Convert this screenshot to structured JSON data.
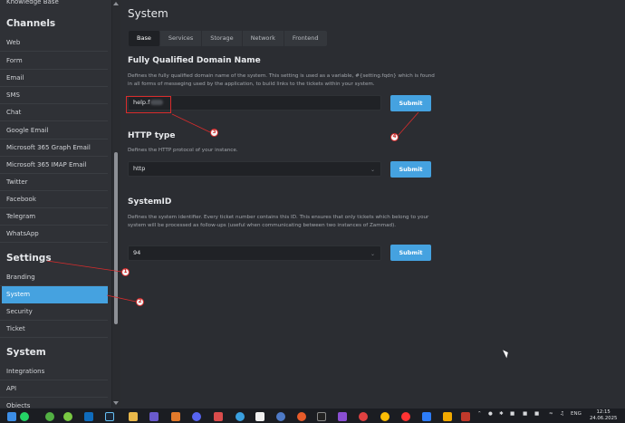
{
  "sidebar": {
    "top_item": "Knowledge Base",
    "channels_heading": "Channels",
    "channels": [
      "Web",
      "Form",
      "Email",
      "SMS",
      "Chat",
      "Google Email",
      "Microsoft 365 Graph Email",
      "Microsoft 365 IMAP Email",
      "Twitter",
      "Facebook",
      "Telegram",
      "WhatsApp"
    ],
    "settings_heading": "Settings",
    "settings": [
      "Branding",
      "System",
      "Security",
      "Ticket"
    ],
    "system_heading": "System",
    "system": [
      "Integrations",
      "API",
      "Objects"
    ]
  },
  "main": {
    "title": "System",
    "tabs": [
      "Base",
      "Services",
      "Storage",
      "Network",
      "Frontend"
    ],
    "active_tab": "Base",
    "sections": {
      "fqdn": {
        "title": "Fully Qualified Domain Name",
        "desc": "Defines the fully qualified domain name of the system. This setting is used as a variable, #{setting.fqdn} which is found in all forms of messeging used by the application, to build links to the tickets within your system.",
        "value": "help.f",
        "button": "Submit"
      },
      "http": {
        "title": "HTTP type",
        "desc": "Defines the HTTP protocol of your instance.",
        "value": "http",
        "button": "Submit"
      },
      "systemid": {
        "title": "SystemID",
        "desc": "Defines the system identifier. Every ticket number contains this ID. This ensures that only tickets which belong to your system will be processed as follow-ups (useful when communicating between two instances of Zammad).",
        "value": "94",
        "button": "Submit"
      }
    }
  },
  "annotations": [
    "1",
    "2",
    "3",
    "4"
  ],
  "taskbar": {
    "lang": "ENG",
    "time": "12:15",
    "date": "24.06.2025",
    "icons": [
      "windows-icon",
      "whatsapp-icon",
      "xbox-icon",
      "robinhood-icon",
      "outlook-icon",
      "steam-icon",
      "file-icon",
      "game-icon",
      "app-icon",
      "discord-icon",
      "photo-icon",
      "edge-icon",
      "music-icon",
      "shield-icon",
      "app2-icon",
      "app3-icon",
      "epic-icon",
      "app4-icon",
      "chrome-icon",
      "yandex-icon",
      "mail-icon",
      "notes-icon",
      "app5-icon",
      "security-icon"
    ]
  },
  "colors": {
    "accent": "#45a2e0",
    "annotation": "#d92c2c"
  }
}
